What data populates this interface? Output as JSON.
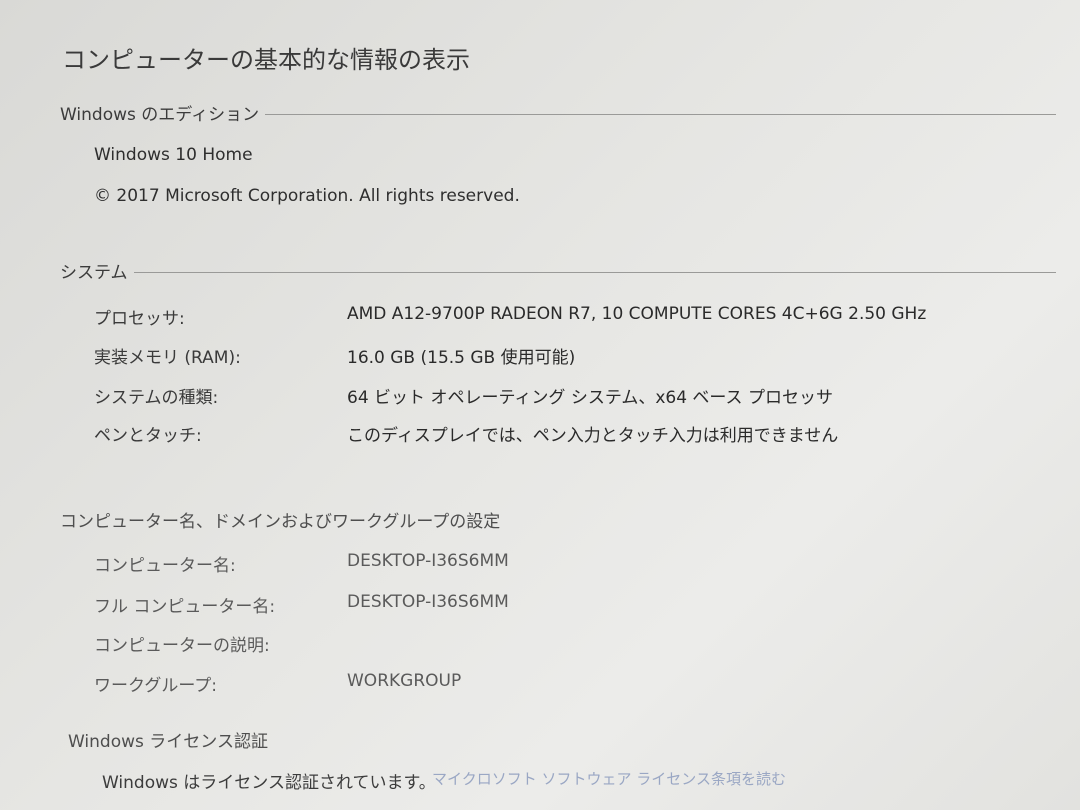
{
  "page_title": "コンピューターの基本的な情報の表示",
  "edition": {
    "header": "Windows のエディション",
    "name": "Windows 10 Home",
    "copyright": "© 2017 Microsoft Corporation. All rights reserved."
  },
  "system": {
    "header": "システム",
    "rows": [
      {
        "label": "プロセッサ:",
        "value": "AMD A12-9700P RADEON R7, 10 COMPUTE CORES 4C+6G   2.50 GHz"
      },
      {
        "label": "実装メモリ (RAM):",
        "value": "16.0 GB (15.5 GB 使用可能)"
      },
      {
        "label": "システムの種類:",
        "value": "64 ビット オペレーティング システム、x64 ベース プロセッサ"
      },
      {
        "label": "ペンとタッチ:",
        "value": "このディスプレイでは、ペン入力とタッチ入力は利用できません"
      }
    ]
  },
  "computer_name": {
    "header": "コンピューター名、ドメインおよびワークグループの設定",
    "rows": [
      {
        "label": "コンピューター名:",
        "value": "DESKTOP-I36S6MM"
      },
      {
        "label": "フル コンピューター名:",
        "value": "DESKTOP-I36S6MM"
      },
      {
        "label": "コンピューターの説明:",
        "value": ""
      },
      {
        "label": "ワークグループ:",
        "value": "WORKGROUP"
      }
    ]
  },
  "license": {
    "header": "Windows ライセンス認証",
    "status": "Windows はライセンス認証されています。",
    "link": "マイクロソフト ソフトウェア ライセンス条項を読む"
  }
}
